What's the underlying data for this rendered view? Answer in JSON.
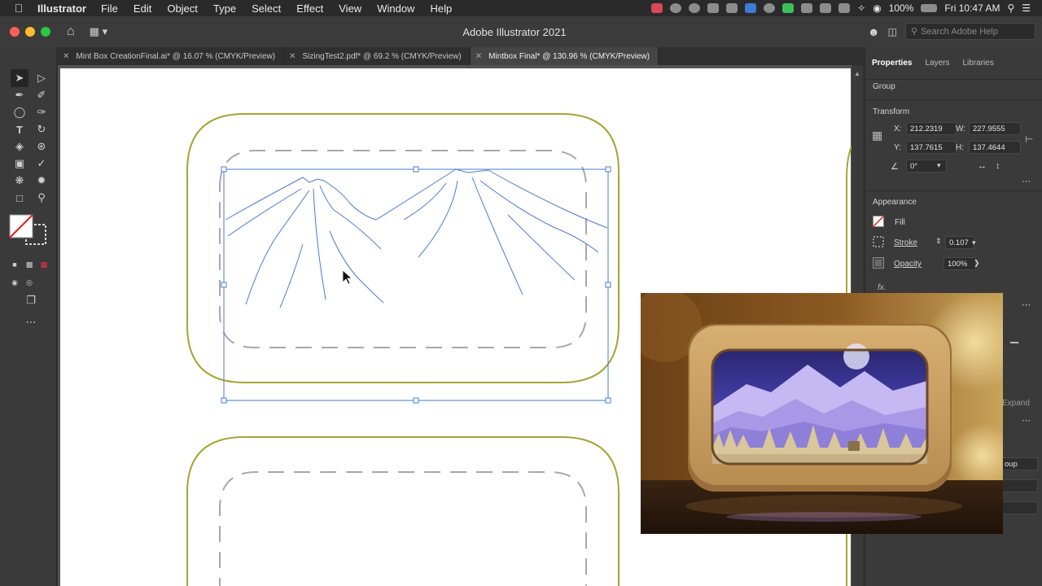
{
  "menubar": {
    "app_name": "Illustrator",
    "items": [
      "File",
      "Edit",
      "Object",
      "Type",
      "Select",
      "Effect",
      "View",
      "Window",
      "Help"
    ],
    "battery": "100%",
    "clock": "Fri 10:47 AM"
  },
  "window": {
    "title": "Adobe Illustrator 2021",
    "search_placeholder": "Search Adobe Help"
  },
  "tabs": [
    {
      "label": "Mint Box CreationFinal.ai* @ 16.07 % (CMYK/Preview)",
      "active": false
    },
    {
      "label": "SizingTest2.pdf* @ 69.2 % (CMYK/Preview)",
      "active": false
    },
    {
      "label": "Mintbox Final* @ 130.96 % (CMYK/Preview)",
      "active": true
    }
  ],
  "properties": {
    "tabs": [
      "Properties",
      "Layers",
      "Libraries"
    ],
    "selection_type": "Group",
    "transform_title": "Transform",
    "x_label": "X:",
    "x_value": "212.2319",
    "y_label": "Y:",
    "y_value": "137.7615",
    "w_label": "W:",
    "w_value": "227.9555",
    "h_label": "H:",
    "h_value": "137.4644",
    "rotate_value": "0°",
    "appearance_title": "Appearance",
    "fill_label": "Fill",
    "stroke_label": "Stroke",
    "stroke_value": "0.107",
    "opacity_label": "Opacity",
    "opacity_value": "100%",
    "fx_label": "fx.",
    "expand_label": "Expand",
    "group_label": "oup"
  },
  "colors": {
    "accent_selection": "#4a7bd0",
    "outline_olive": "#a7a436",
    "dash_gray": "#a8a8a8"
  }
}
